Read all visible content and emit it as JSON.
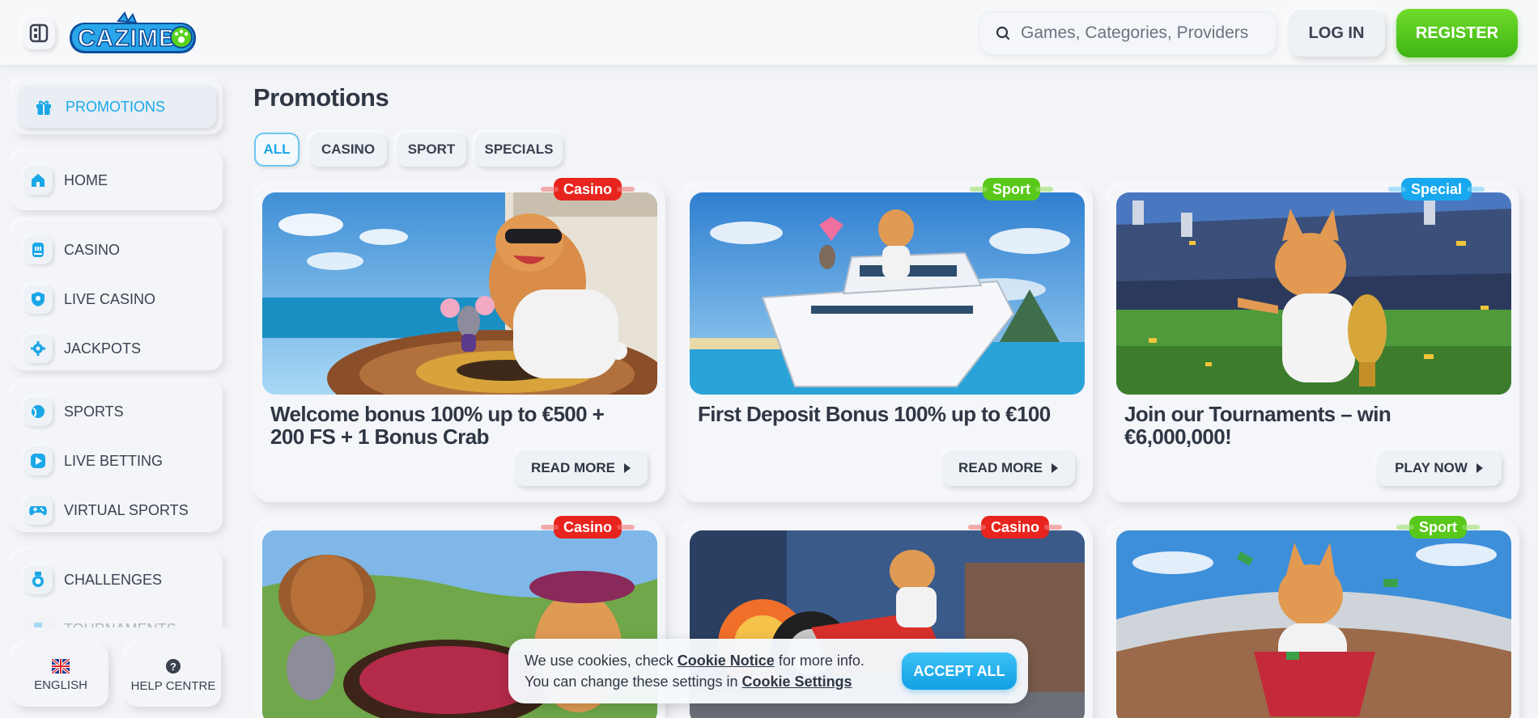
{
  "header": {
    "logo_text": "CAZIMBO",
    "search_placeholder": "Games, Categories, Providers",
    "login_label": "LOG IN",
    "register_label": "REGISTER"
  },
  "sidebar": {
    "items": [
      {
        "label": "PROMOTIONS",
        "icon": "gift-icon",
        "active": true
      },
      {
        "label": "HOME",
        "icon": "home-icon"
      },
      {
        "label": "CASINO",
        "icon": "slot-machine-icon"
      },
      {
        "label": "LIVE CASINO",
        "icon": "live-dealer-icon"
      },
      {
        "label": "JACKPOTS",
        "icon": "jackpot-gear-icon"
      },
      {
        "label": "SPORTS",
        "icon": "sports-ball-icon"
      },
      {
        "label": "LIVE BETTING",
        "icon": "play-icon"
      },
      {
        "label": "VIRTUAL SPORTS",
        "icon": "gamepad-icon"
      },
      {
        "label": "CHALLENGES",
        "icon": "medal-icon"
      },
      {
        "label": "TOURNAMENTS",
        "icon": "trophy-icon"
      }
    ],
    "language_label": "ENGLISH",
    "help_label": "HELP CENTRE"
  },
  "main": {
    "title": "Promotions",
    "filters": [
      "ALL",
      "CASINO",
      "SPORT",
      "SPECIALS"
    ],
    "active_filter": "ALL",
    "cards": [
      {
        "tag": "Casino",
        "title": "Welcome bonus 100% up to €500 + 200 FS + 1 Bonus Crab",
        "button": "READ MORE"
      },
      {
        "tag": "Sport",
        "title": "First Deposit Bonus 100% up to €100",
        "button": "READ MORE"
      },
      {
        "tag": "Special",
        "title": "Join our Tournaments – win €6,000,000!",
        "button": "PLAY NOW"
      },
      {
        "tag": "Casino",
        "title": "",
        "button": ""
      },
      {
        "tag": "Casino",
        "title": "",
        "button": ""
      },
      {
        "tag": "Sport",
        "title": "",
        "button": ""
      }
    ]
  },
  "cookie": {
    "line1_prefix": "We use cookies, check",
    "line1_link": "Cookie Notice",
    "line1_suffix": "for more info.",
    "line2_prefix": "You can change these settings in",
    "line2_link": "Cookie Settings",
    "accept_label": "ACCEPT ALL"
  },
  "colors": {
    "accent_blue": "#1aa7e8",
    "register_green": "#4fc41a",
    "tag_casino": "#e8241e",
    "tag_sport": "#59c81a",
    "tag_special": "#18a8ef"
  }
}
